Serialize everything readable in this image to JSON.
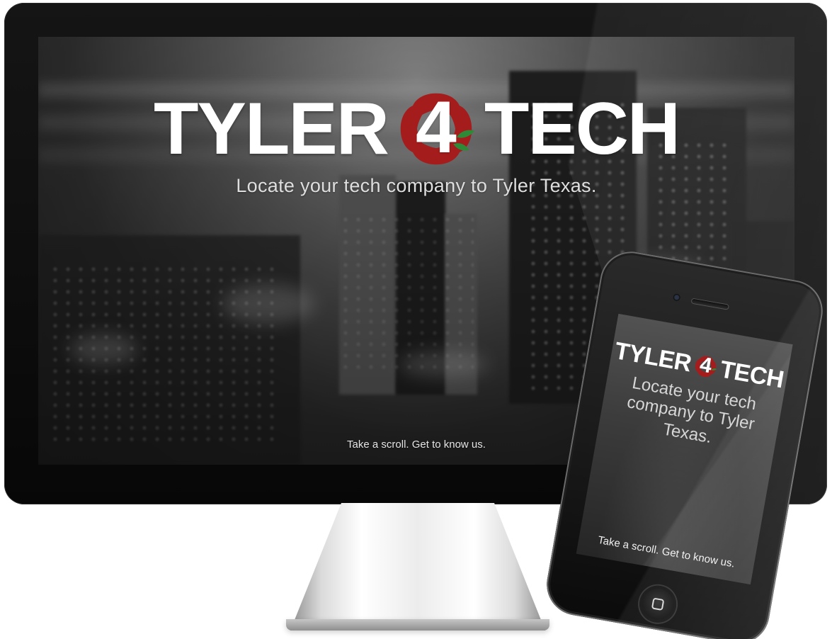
{
  "desktop": {
    "logo_left": "TYLER",
    "logo_number": "4",
    "logo_right": "TECH",
    "tagline": "Locate your tech company to Tyler Texas.",
    "scroll_text": "Take a scroll. Get to know us."
  },
  "phone": {
    "logo_left": "TYLER",
    "logo_number": "4",
    "logo_right": "TECH",
    "tagline": "Locate your tech\ncompany to Tyler\nTexas.",
    "scroll_text": "Take a scroll. Get to know us."
  },
  "icons": {
    "monitor_logo_mark": "rose-logo-icon",
    "phone_logo_mark": "rose-logo-icon",
    "phone_home_button": "home-button-icon"
  },
  "colors": {
    "brand_red": "#a51c1c",
    "brand_green": "#2f8a37",
    "text_white": "#ffffff",
    "screen_dark": "#2b2b2b"
  }
}
